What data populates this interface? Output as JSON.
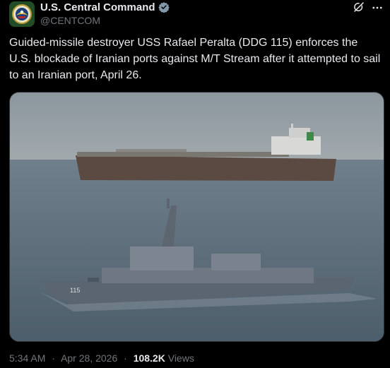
{
  "account": {
    "display_name": "U.S. Central Command",
    "handle": "@CENTCOM",
    "verified": true,
    "avatar": "centcom-emblem"
  },
  "icons": {
    "verified": "verified-badge-icon",
    "grok": "grok-icon",
    "more": "more-options-icon"
  },
  "colors": {
    "background": "#000000",
    "text": "#e7e9ea",
    "muted": "#71767b",
    "verified_badge": "#829aab"
  },
  "tweet": {
    "text": "Guided-missile destroyer USS Rafael Peralta (DDG 115) enforces the U.S. blockade of Iranian ports against M/T Stream after it attempted to sail to an Iranian port, April 26.",
    "image_alt": "Destroyer USS Rafael Peralta in the foreground with tanker M/T Stream on the horizon",
    "hull_number": "115"
  },
  "meta": {
    "time": "5:34 AM",
    "separator": "·",
    "date": "Apr 28, 2026",
    "views_count": "108.2K",
    "views_label": "Views"
  }
}
